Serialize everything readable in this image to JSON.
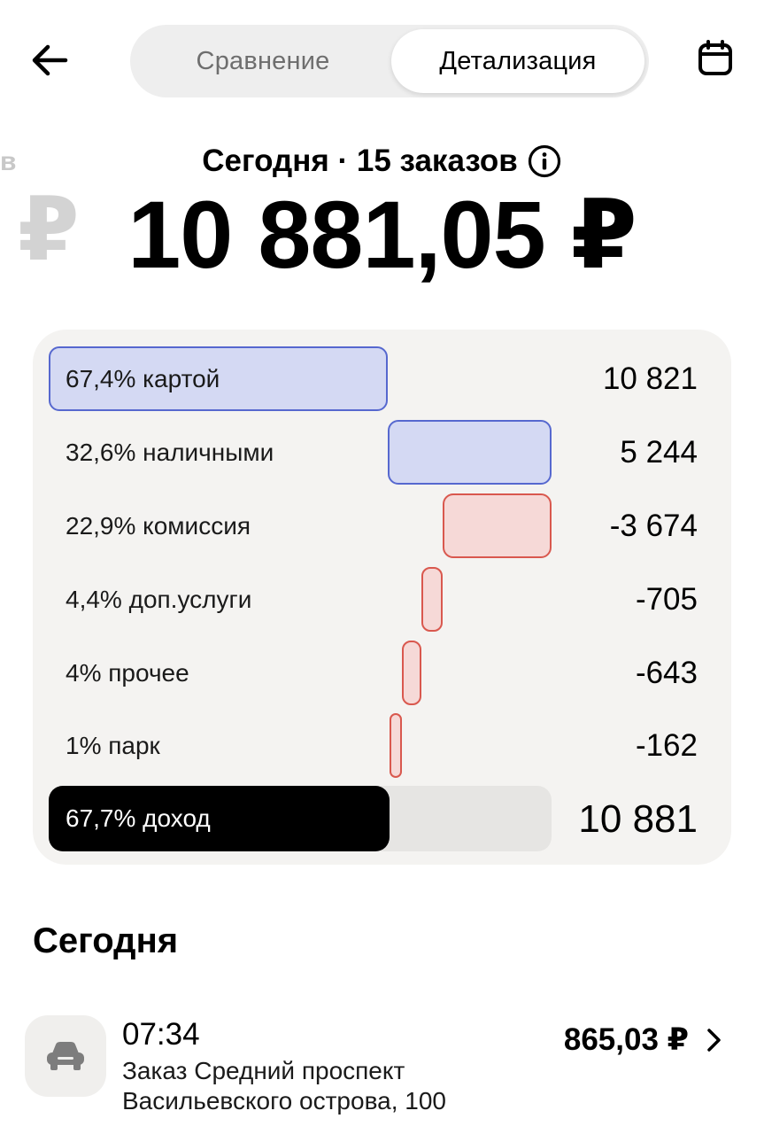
{
  "header": {
    "tabs": [
      {
        "label": "Сравнение",
        "active": false
      },
      {
        "label": "Детализация",
        "active": true
      }
    ]
  },
  "summary": {
    "subtitle": "Сегодня · 15 заказов",
    "total": "10 881,05 ₽",
    "ghost_left_letter": "в",
    "ghost_left_currency": "₽"
  },
  "breakdown": {
    "rows": [
      {
        "label": "67,4% картой",
        "value": "10 821",
        "type": "income",
        "share_pct": 67.4
      },
      {
        "label": "32,6% наличными",
        "value": "5 244",
        "type": "income",
        "share_pct": 32.6
      },
      {
        "label": "22,9% комиссия",
        "value": "-3 674",
        "type": "expense",
        "share_pct": 22.9
      },
      {
        "label": "4,4% доп.услуги",
        "value": "-705",
        "type": "expense",
        "share_pct": 4.4
      },
      {
        "label": "4% прочее",
        "value": "-643",
        "type": "expense",
        "share_pct": 4
      },
      {
        "label": "1% парк",
        "value": "-162",
        "type": "expense",
        "share_pct": 1
      },
      {
        "label": "67,7% доход",
        "value": "10 881",
        "type": "result",
        "share_pct": 67.7
      }
    ],
    "colors": {
      "income_fill": "#d4d9f3",
      "income_border": "#5668cf",
      "expense_fill": "#f6d9d7",
      "expense_border": "#d9584e",
      "result_fill": "#000000",
      "track": "#e6e5e3"
    }
  },
  "section": {
    "title": "Сегодня"
  },
  "orders": [
    {
      "time": "07:34",
      "description": "Заказ Средний проспект Васильевского острова, 100",
      "amount": "865,03 ₽",
      "icon": "car-icon"
    }
  ],
  "icons": {
    "back": "arrow-left-icon",
    "calendar": "calendar-icon",
    "info": "info-icon",
    "chevron": "chevron-right-icon"
  }
}
